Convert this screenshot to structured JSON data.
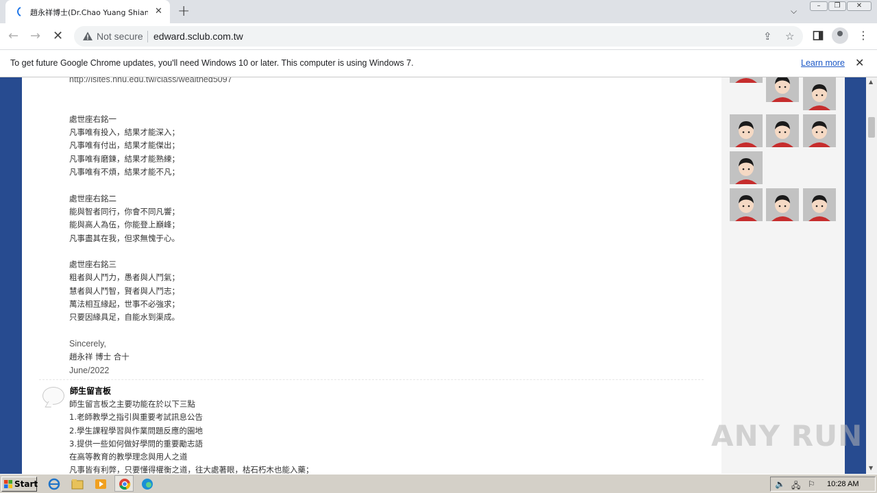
{
  "browser": {
    "tab_title": "趙永祥博士(Dr.Chao Yuang Shiang)",
    "not_secure": "Not secure",
    "url": "edward.sclub.com.tw"
  },
  "infobar": {
    "message": "To get future Google Chrome updates, you'll need Windows 10 or later. This computer is using Windows 7.",
    "learn_more": "Learn more"
  },
  "article": {
    "link": "http://isites.nhu.edu.tw/class/wealthed5097",
    "motto1": {
      "title": "處世座右銘一",
      "lines": [
        "凡事唯有投入，結果才能深入；",
        "凡事唯有付出，結果才能傑出；",
        "凡事唯有磨鍊，結果才能熟練；",
        "凡事唯有不煩，結果才能不凡；"
      ]
    },
    "motto2": {
      "title": "處世座右銘二",
      "lines": [
        "能與智者同行，你會不同凡響；",
        "能與高人為伍，你能登上巔峰；",
        "凡事盡其在我，但求無愧于心。"
      ]
    },
    "motto3": {
      "title": "處世座右銘三",
      "lines": [
        "粗者與人鬥力，愚者與人鬥氣；",
        "慧者與人鬥智，賢者與人鬥志；",
        "萬法相互緣起，世事不必強求；",
        "只要因緣具足，自能水到渠成。"
      ]
    },
    "sign_off": "Sincerely,",
    "signature": "趙永祥  博士 合十",
    "date": "June/2022"
  },
  "message_board": {
    "title": "師生留言板",
    "lines": [
      "師生留言板之主要功能在於以下三點",
      "1.老師教學之指引與重要考試訊息公告",
      "2.學生課程學習與作業問題反應的園地",
      "3.提供一些如何做好學問的重要勵志語",
      "在高等教育的教學理念與用人之道",
      "凡事皆有利弊，只要懂得權衡之道，往大處著眼，枯石朽木也能入藥；"
    ]
  },
  "watermark": "ANY RUN",
  "taskbar": {
    "start_label": "Start",
    "clock": "10:28 AM"
  }
}
